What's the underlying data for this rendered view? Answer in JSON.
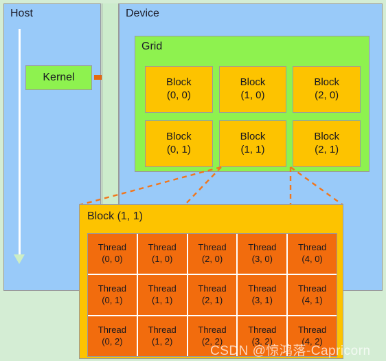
{
  "diagram": {
    "host": {
      "title": "Host"
    },
    "device": {
      "title": "Device"
    },
    "kernel": {
      "label": "Kernel"
    },
    "grid": {
      "title": "Grid",
      "blocks": [
        [
          {
            "name": "Block",
            "index": "(0, 0)"
          },
          {
            "name": "Block",
            "index": "(1, 0)"
          },
          {
            "name": "Block",
            "index": "(2, 0)"
          }
        ],
        [
          {
            "name": "Block",
            "index": "(0, 1)"
          },
          {
            "name": "Block",
            "index": "(1, 1)"
          },
          {
            "name": "Block",
            "index": "(2, 1)"
          }
        ]
      ]
    },
    "detail": {
      "title": "Block (1, 1)",
      "threads": [
        [
          {
            "name": "Thread",
            "index": "(0, 0)"
          },
          {
            "name": "Thread",
            "index": "(1, 0)"
          },
          {
            "name": "Thread",
            "index": "(2, 0)"
          },
          {
            "name": "Thread",
            "index": "(3, 0)"
          },
          {
            "name": "Thread",
            "index": "(4, 0)"
          }
        ],
        [
          {
            "name": "Thread",
            "index": "(0, 1)"
          },
          {
            "name": "Thread",
            "index": "(1, 1)"
          },
          {
            "name": "Thread",
            "index": "(2, 1)"
          },
          {
            "name": "Thread",
            "index": "(3, 1)"
          },
          {
            "name": "Thread",
            "index": "(4, 1)"
          }
        ],
        [
          {
            "name": "Thread",
            "index": "(0, 2)"
          },
          {
            "name": "Thread",
            "index": "(1, 2)"
          },
          {
            "name": "Thread",
            "index": "(2, 2)"
          },
          {
            "name": "Thread",
            "index": "(3, 2)"
          },
          {
            "name": "Thread",
            "index": "(4, 2)"
          }
        ]
      ]
    },
    "watermark": "CSDN @惊鸿落-Capricorn",
    "colors": {
      "host_device_fill": "#99caf9",
      "strip_fill": "#cceccc",
      "page_background": "#d4edd4",
      "grid_fill": "#8ef24f",
      "kernel_fill": "#8ef24f",
      "block_fill": "#fdc300",
      "thread_fill": "#f26c0d",
      "arrow_orange": "#e5690f",
      "dashed_line": "#f2761b",
      "host_arrow_white": "#ffffff",
      "host_arrow_head": "#cdeec4",
      "box_border": "#9a9a9a"
    }
  }
}
